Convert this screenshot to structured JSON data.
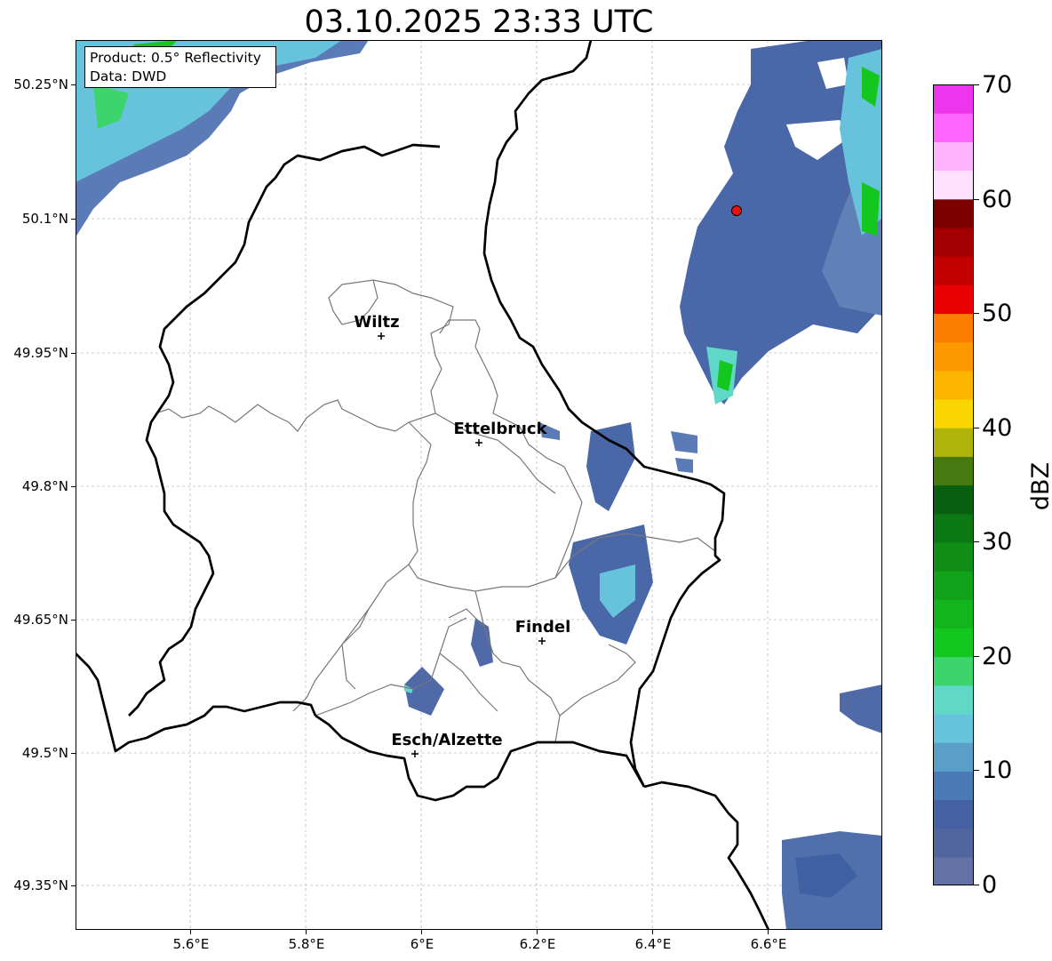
{
  "title": "03.10.2025 23:33 UTC",
  "info_box": {
    "product": "Product: 0.5° Reflectivity",
    "data_source": "Data: DWD"
  },
  "axes": {
    "y_ticks": [
      "50.25°N",
      "50.1°N",
      "49.95°N",
      "49.8°N",
      "49.65°N",
      "49.5°N",
      "49.35°N"
    ],
    "x_ticks": [
      "5.6°E",
      "5.8°E",
      "6°E",
      "6.2°E",
      "6.4°E",
      "6.6°E"
    ]
  },
  "cities": [
    {
      "name": "Wiltz"
    },
    {
      "name": "Ettelbruck"
    },
    {
      "name": "Findel"
    },
    {
      "name": "Esch/Alzette"
    }
  ],
  "colorbar": {
    "unit": "dBZ",
    "min": 0,
    "max": 70,
    "tick_labels": [
      "0",
      "10",
      "20",
      "30",
      "40",
      "50",
      "60",
      "70"
    ],
    "colors": [
      "#6272a6",
      "#51659e",
      "#4560a3",
      "#4a7ab5",
      "#5a9fc8",
      "#67c3dc",
      "#5fd8c7",
      "#3cd56c",
      "#14c71f",
      "#12b51b",
      "#12a21a",
      "#0f8d14",
      "#0b7813",
      "#075f0f",
      "#467a11",
      "#afb30a",
      "#fad600",
      "#fcb600",
      "#fc9900",
      "#fc7d00",
      "#e90000",
      "#c30000",
      "#a20000",
      "#7c0000",
      "#ffe1ff",
      "#ffb4ff",
      "#ff66ff",
      "#ec35ec"
    ]
  },
  "radar_site_color": "#ee1111"
}
